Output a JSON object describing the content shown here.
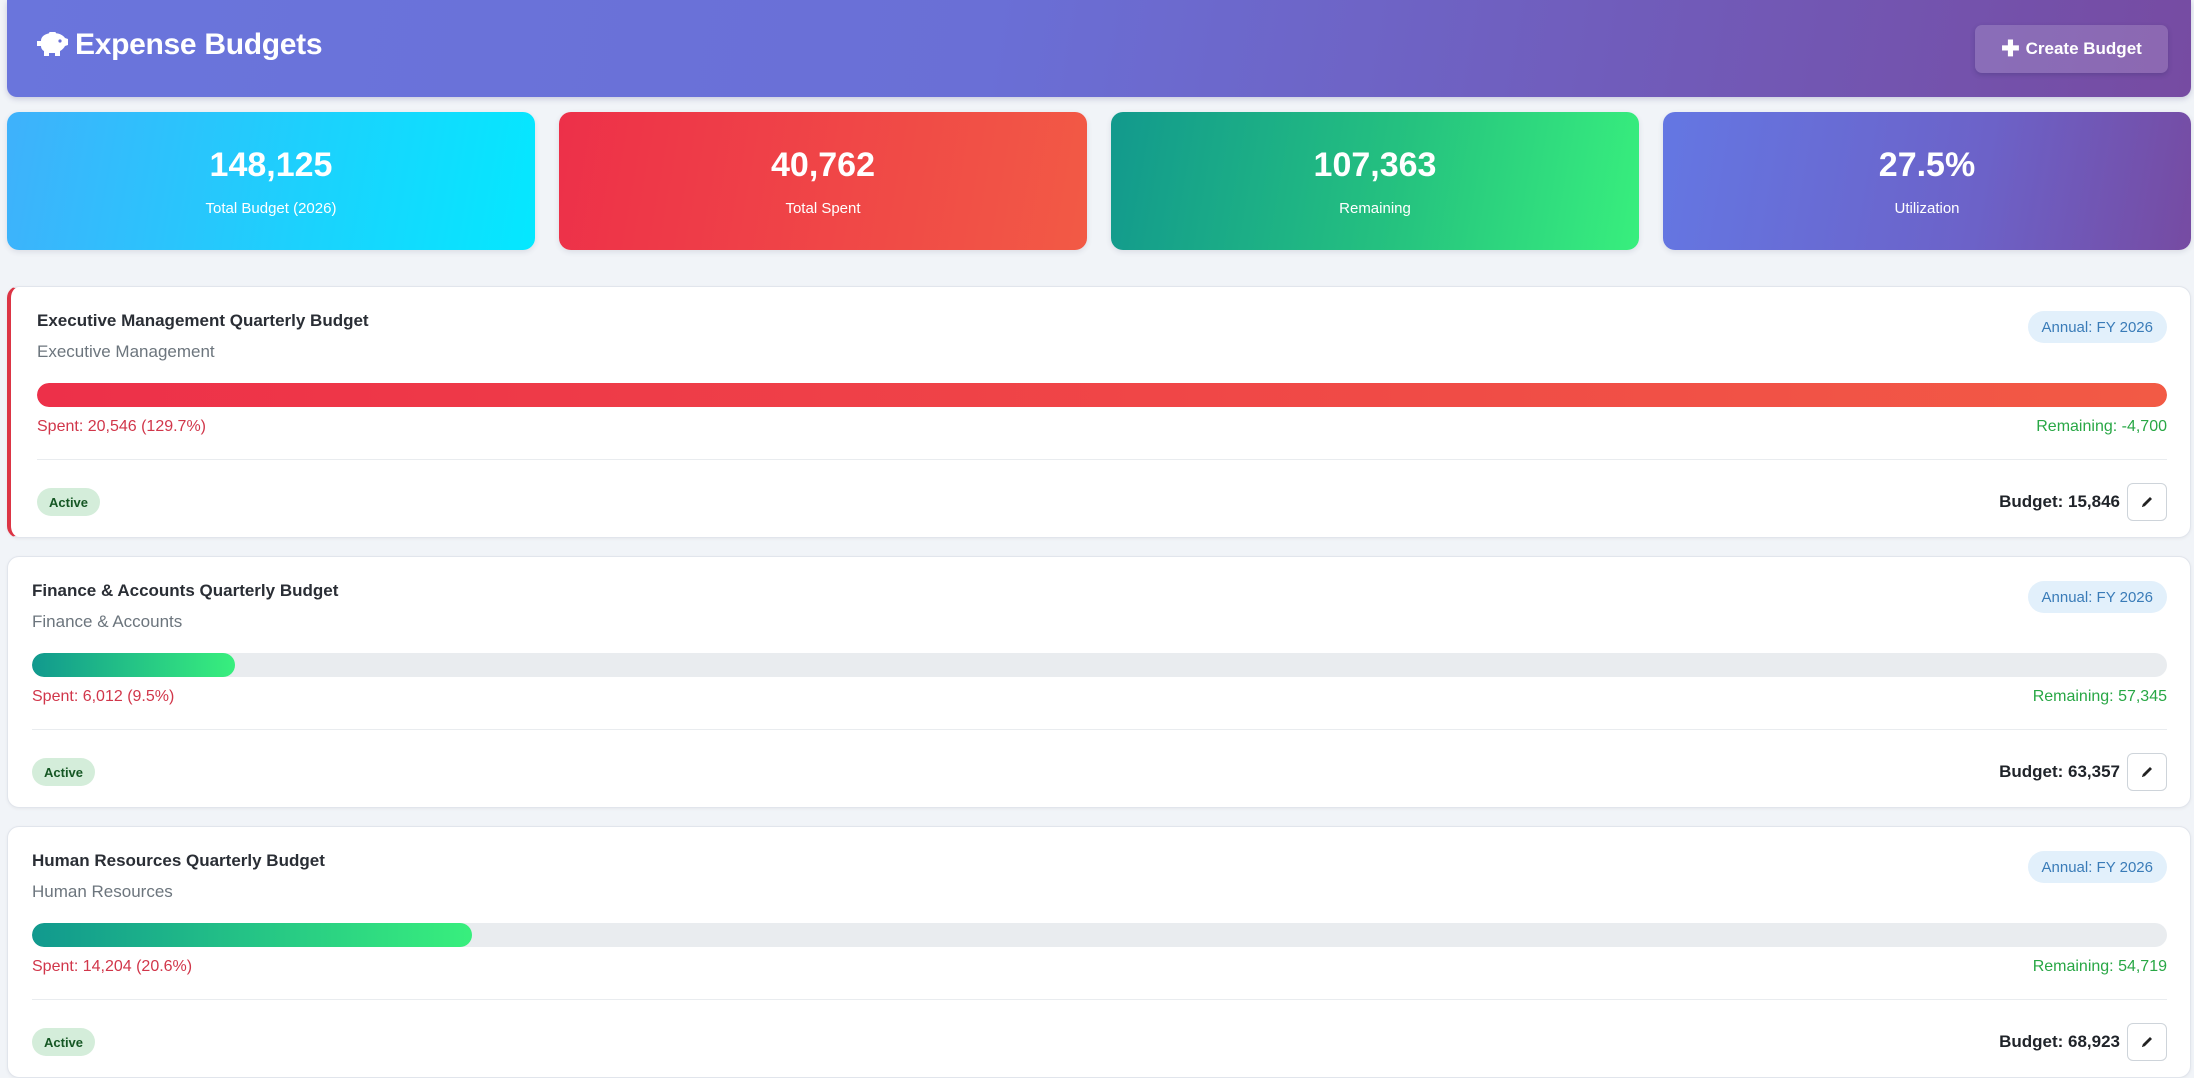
{
  "header": {
    "title": "Expense Budgets",
    "title_icon": "piggy-bank-icon",
    "create_label": "Create Budget",
    "create_icon": "plus-icon"
  },
  "stats": [
    {
      "value": "148,125",
      "label": "Total Budget (2026)",
      "color": "#04e8ff"
    },
    {
      "value": "40,762",
      "label": "Total Spent",
      "color": "#ed3049"
    },
    {
      "value": "107,363",
      "label": "Remaining",
      "color": "#38ef7d"
    },
    {
      "value": "27.5%",
      "label": "Utilization",
      "color": "#764ba2"
    }
  ],
  "budgets": [
    {
      "title": "Executive Management Quarterly Budget",
      "department": "Executive Management",
      "period": "Annual: FY 2026",
      "spent_text": "Spent: 20,546 (129.7%)",
      "remaining_text": "Remaining: -4,700",
      "status": "Active",
      "budget_text": "Budget: 15,846",
      "progress_fraction": 1.0,
      "progress_color": "red"
    },
    {
      "title": "Finance & Accounts Quarterly Budget",
      "department": "Finance & Accounts",
      "period": "Annual: FY 2026",
      "spent_text": "Spent: 6,012 (9.5%)",
      "remaining_text": "Remaining: 57,345",
      "status": "Active",
      "budget_text": "Budget: 63,357",
      "progress_fraction": 0.095,
      "progress_color": "green"
    },
    {
      "title": "Human Resources Quarterly Budget",
      "department": "Human Resources",
      "period": "Annual: FY 2026",
      "spent_text": "Spent: 14,204 (20.6%)",
      "remaining_text": "Remaining: 54,719",
      "status": "Active",
      "budget_text": "Budget: 68,923",
      "progress_fraction": 0.206,
      "progress_color": "green"
    }
  ],
  "colors": {
    "header_start": "#667eea",
    "header_end": "#764ba2",
    "danger": "#dc3545",
    "success": "#28a745",
    "active_badge_bg": "#d4edda"
  }
}
